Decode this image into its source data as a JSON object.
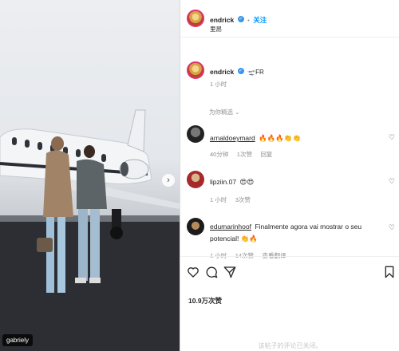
{
  "photo": {
    "tag": "gabriely",
    "next_arrow": "›"
  },
  "header": {
    "username": "endrick",
    "follow": "关注",
    "location": "里昂"
  },
  "caption": {
    "username": "endrick",
    "text": "🛫FR",
    "time": "1 小时"
  },
  "sort_label": "为你精选 ⌄",
  "comments": [
    {
      "username": "arnaldoeymard",
      "text": "🔥🔥🔥👏👏",
      "time": "40分钟",
      "likes": "1次赞",
      "reply": "回复"
    },
    {
      "username": "lipziin.07",
      "text": "😍😍",
      "time": "1 小时",
      "likes": "3次赞"
    },
    {
      "username": "edumarinhoof",
      "text": "Finalmente agora vai mostrar o seu potencial! 👏🔥",
      "time": "1 小时",
      "likes": "14次赞",
      "translate": "查看翻译"
    }
  ],
  "likes_count": "10.9万次赞",
  "footer_note": "该帖子的评论已关闭。",
  "icons": {
    "like": "heart-icon",
    "comment": "comment-icon",
    "share": "share-icon",
    "save": "bookmark-icon"
  },
  "colors": {
    "link": "#0095f6",
    "verified": "#3897f0"
  }
}
